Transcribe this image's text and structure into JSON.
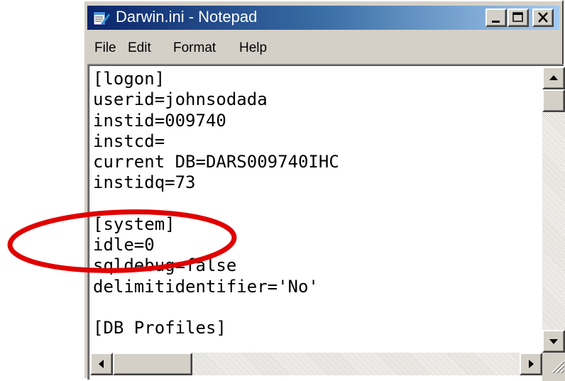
{
  "window": {
    "title": "Darwin.ini - Notepad",
    "controls": {
      "minimize": "minimize",
      "maximize": "maximize",
      "close": "close"
    }
  },
  "menu": {
    "file": "File",
    "edit": "Edit",
    "format": "Format",
    "help": "Help"
  },
  "editor": {
    "lines": [
      "[logon]",
      "userid=johnsodada",
      "instid=009740",
      "instcd=",
      "current DB=DARS009740IHC",
      "instidq=73",
      "",
      "[system]",
      "idle=0",
      "sqldebug=false",
      "delimitidentifier='No'",
      "",
      "[DB Profiles]"
    ]
  },
  "annotation": {
    "color": "#e00000",
    "target": "idle=0"
  },
  "colors": {
    "titlebar_start": "#0a246a",
    "titlebar_end": "#a6caf0",
    "chrome": "#d4d0c8"
  },
  "icons": {
    "app": "notepad-icon",
    "minimize": "minimize-icon",
    "maximize": "maximize-icon",
    "close": "close-icon"
  }
}
